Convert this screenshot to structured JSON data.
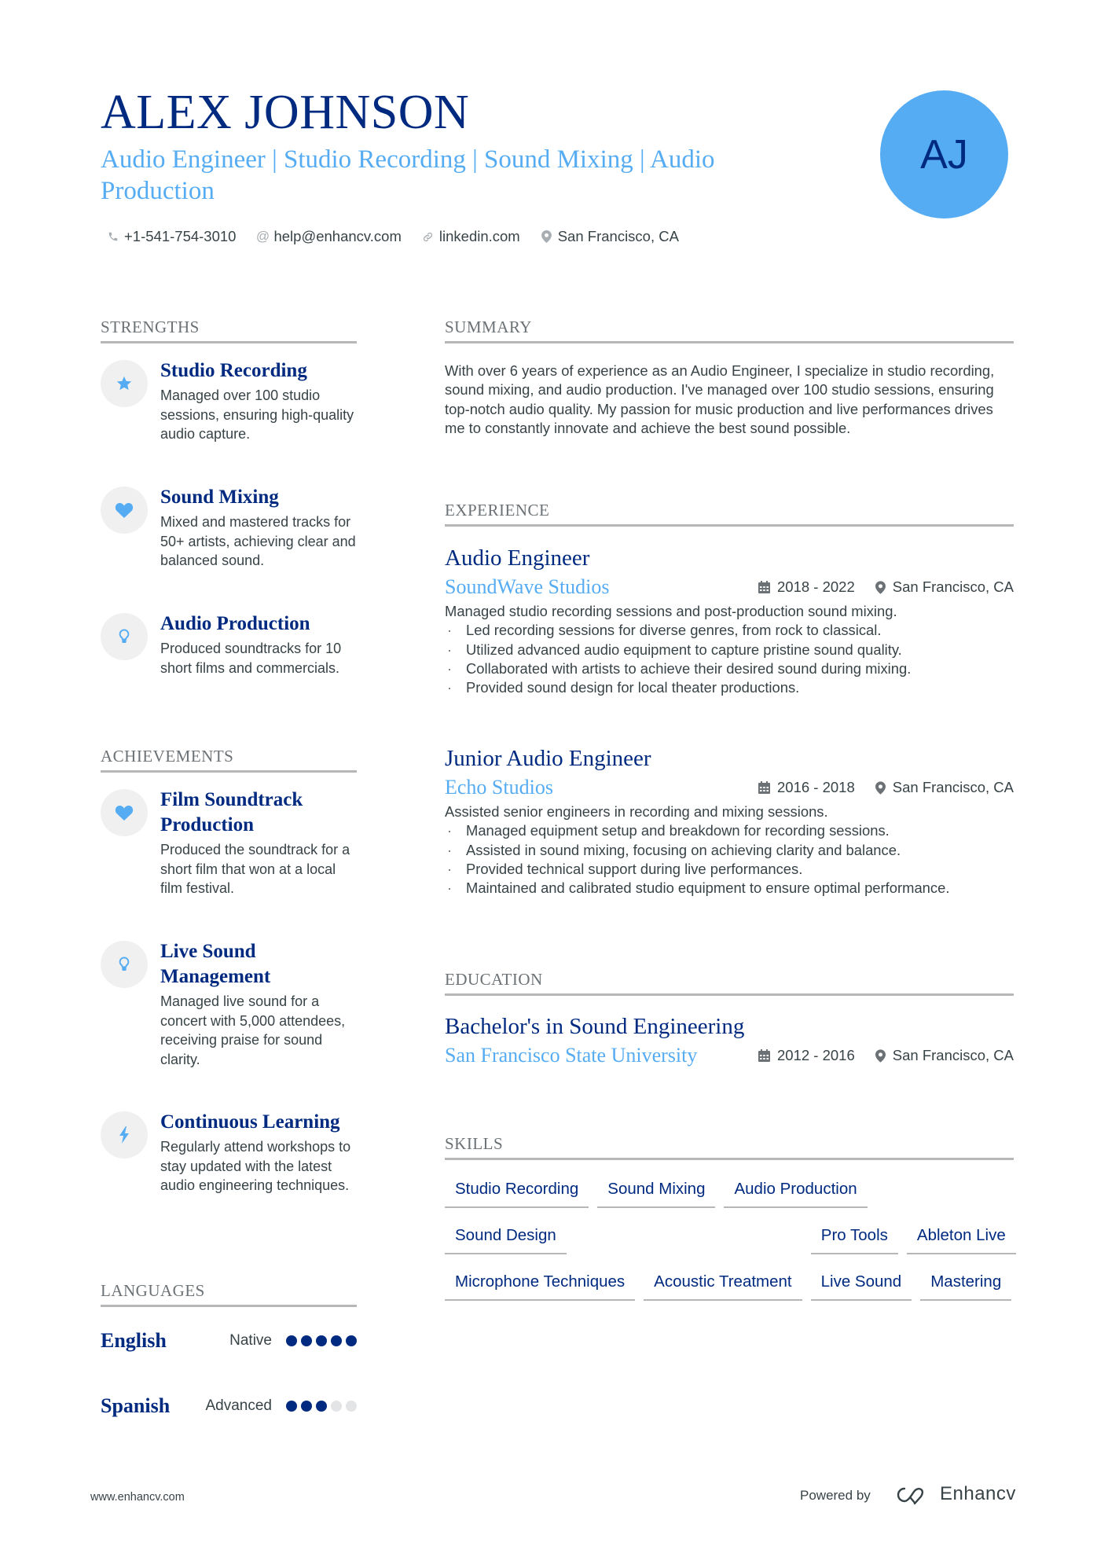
{
  "header": {
    "name": "ALEX JOHNSON",
    "headline": "Audio Engineer | Studio Recording | Sound Mixing | Audio Production",
    "initials": "AJ",
    "contacts": [
      {
        "icon": "phone-icon",
        "text": "+1-541-754-3010"
      },
      {
        "icon": "at-icon",
        "text": "help@enhancv.com"
      },
      {
        "icon": "link-icon",
        "text": "linkedin.com"
      },
      {
        "icon": "location-pin-icon",
        "text": "San Francisco, CA"
      }
    ]
  },
  "colors": {
    "primary": "#002a80",
    "accent": "#56acf2",
    "text": "#384347",
    "muted": "#6b7175",
    "divider": "#b5b7b9"
  },
  "strengths": {
    "title": "STRENGTHS",
    "items": [
      {
        "icon": "star-icon",
        "title": "Studio Recording",
        "desc": "Managed over 100 studio sessions, ensuring high-quality audio capture."
      },
      {
        "icon": "heart-icon",
        "title": "Sound Mixing",
        "desc": "Mixed and mastered tracks for 50+ artists, achieving clear and balanced sound."
      },
      {
        "icon": "lightbulb-icon",
        "title": "Audio Production",
        "desc": "Produced soundtracks for 10 short films and commercials."
      }
    ]
  },
  "achievements": {
    "title": "ACHIEVEMENTS",
    "items": [
      {
        "icon": "heart-icon",
        "title": "Film Soundtrack Production",
        "desc": "Produced the soundtrack for a short film that won at a local film festival."
      },
      {
        "icon": "lightbulb-icon",
        "title": "Live Sound Management",
        "desc": "Managed live sound for a concert with 5,000 attendees, receiving praise for sound clarity."
      },
      {
        "icon": "lightning-icon",
        "title": "Continuous Learning",
        "desc": "Regularly attend workshops to stay updated with the latest audio engineering techniques."
      }
    ]
  },
  "languages": {
    "title": "LANGUAGES",
    "items": [
      {
        "name": "English",
        "level": "Native",
        "rating": 5,
        "max": 5
      },
      {
        "name": "Spanish",
        "level": "Advanced",
        "rating": 3,
        "max": 5
      }
    ]
  },
  "summary": {
    "title": "SUMMARY",
    "text": "With over 6 years of experience as an Audio Engineer, I specialize in studio recording, sound mixing, and audio production. I've managed over 100 studio sessions, ensuring top-notch audio quality. My passion for music production and live performances drives me to constantly innovate and achieve the best sound possible."
  },
  "experience": {
    "title": "EXPERIENCE",
    "jobs": [
      {
        "title": "Audio Engineer",
        "company": "SoundWave Studios",
        "dates": "2018 - 2022",
        "location": "San Francisco, CA",
        "desc": "Managed studio recording sessions and post-production sound mixing.",
        "bullets": [
          "Led recording sessions for diverse genres, from rock to classical.",
          "Utilized advanced audio equipment to capture pristine sound quality.",
          "Collaborated with artists to achieve their desired sound during mixing.",
          "Provided sound design for local theater productions."
        ]
      },
      {
        "title": "Junior Audio Engineer",
        "company": "Echo Studios",
        "dates": "2016 - 2018",
        "location": "San Francisco, CA",
        "desc": "Assisted senior engineers in recording and mixing sessions.",
        "bullets": [
          "Managed equipment setup and breakdown for recording sessions.",
          "Assisted in sound mixing, focusing on achieving clarity and balance.",
          "Provided technical support during live performances.",
          "Maintained and calibrated studio equipment to ensure optimal performance."
        ]
      }
    ]
  },
  "education": {
    "title": "EDUCATION",
    "items": [
      {
        "degree": "Bachelor's in Sound Engineering",
        "school": "San Francisco State University",
        "dates": "2012 - 2016",
        "location": "San Francisco, CA"
      }
    ]
  },
  "skills": {
    "title": "SKILLS",
    "items": [
      "Studio Recording",
      "Sound Mixing",
      "Audio Production",
      "Sound Design",
      "Pro Tools",
      "Ableton Live",
      "Microphone Techniques",
      "Acoustic Treatment",
      "Live Sound",
      "Mastering"
    ]
  },
  "footer": {
    "url": "www.enhancv.com",
    "powered_by": "Powered by",
    "brand": "Enhancv"
  }
}
